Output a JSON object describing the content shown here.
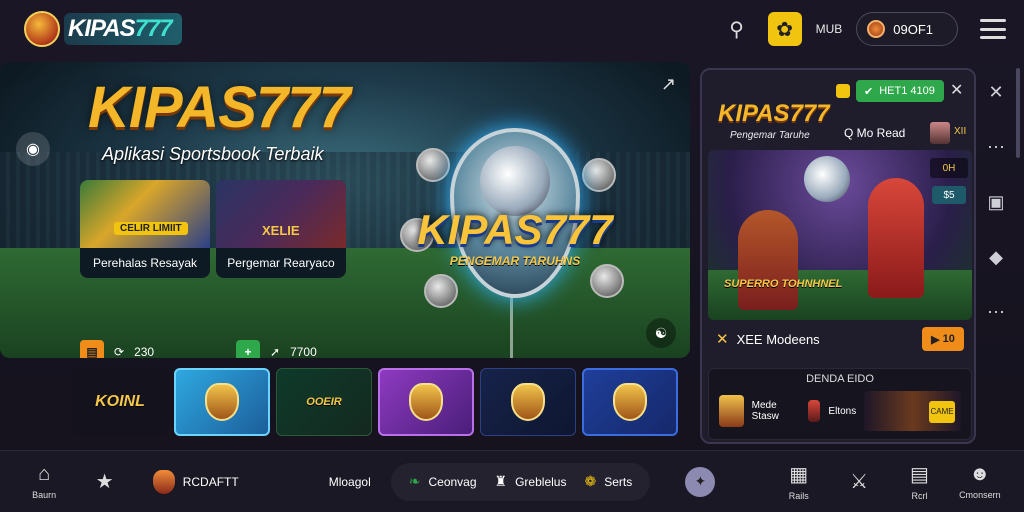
{
  "header": {
    "logo_text": "KIPAS",
    "logo_num": "777",
    "search_icon": "search-icon",
    "yellow_icon": "settings-icon",
    "small_label": "MUB",
    "coin_value": "09OF1",
    "menu_icon": "hamburger-icon"
  },
  "hero": {
    "title": "KIPAS777",
    "subtitle": "Aplikasi Sportsbook Terbaik",
    "emblem_word": "KIPAS777",
    "emblem_tagline": "PENGEMAR TARUHNS",
    "cards": [
      {
        "label": "Perehalas Resayak",
        "tag": "CELIR LIMIIT",
        "stat_value": "230",
        "chip_color": "#f08c1a"
      },
      {
        "label": "Pergemar Rearyaco",
        "tag": "XELIE",
        "stat_value": "7700",
        "chip_color": "#2ea84a"
      }
    ]
  },
  "games": [
    {
      "label": "KOINL"
    },
    {
      "label": ""
    },
    {
      "label": "OOEIR"
    },
    {
      "label": ""
    },
    {
      "label": ""
    },
    {
      "label": ""
    }
  ],
  "panel": {
    "title": "KIPAS777",
    "subtitle": "Pengemar Taruhe",
    "green_label": "HET1 4109",
    "user": "Q Mo Read",
    "user_tag": "XII",
    "media_label": "SUPERRO TOHNHNEL",
    "mini1": "0H",
    "mini2": "$5",
    "row_label": "XEE Modeens",
    "row_btn": "10",
    "box_title": "DENDA EIDO",
    "box_item": "Mede Stasw",
    "box_item2": "Eltons",
    "banner_badge": "CAME"
  },
  "bottom": {
    "nav": [
      {
        "label": "Baurn",
        "icon": "home-icon"
      },
      {
        "label": "",
        "icon": "star-icon"
      }
    ],
    "promo_label": "RCDAFTT",
    "center_label": "Mloagol",
    "chips": [
      {
        "label": "Ceonvag",
        "icon": "leaf-icon"
      },
      {
        "label": "Greblelus",
        "icon": "shield-icon"
      },
      {
        "label": "Serts",
        "icon": "gear-icon"
      }
    ],
    "right_nav": [
      {
        "label": "",
        "icon": "spark-icon"
      },
      {
        "label": "Rails",
        "icon": "calendar-icon"
      },
      {
        "label": "",
        "icon": "flag-icon"
      },
      {
        "label": "Rcrl",
        "icon": "doc-icon"
      },
      {
        "label": "Cmonsern",
        "icon": "user-icon"
      }
    ]
  }
}
